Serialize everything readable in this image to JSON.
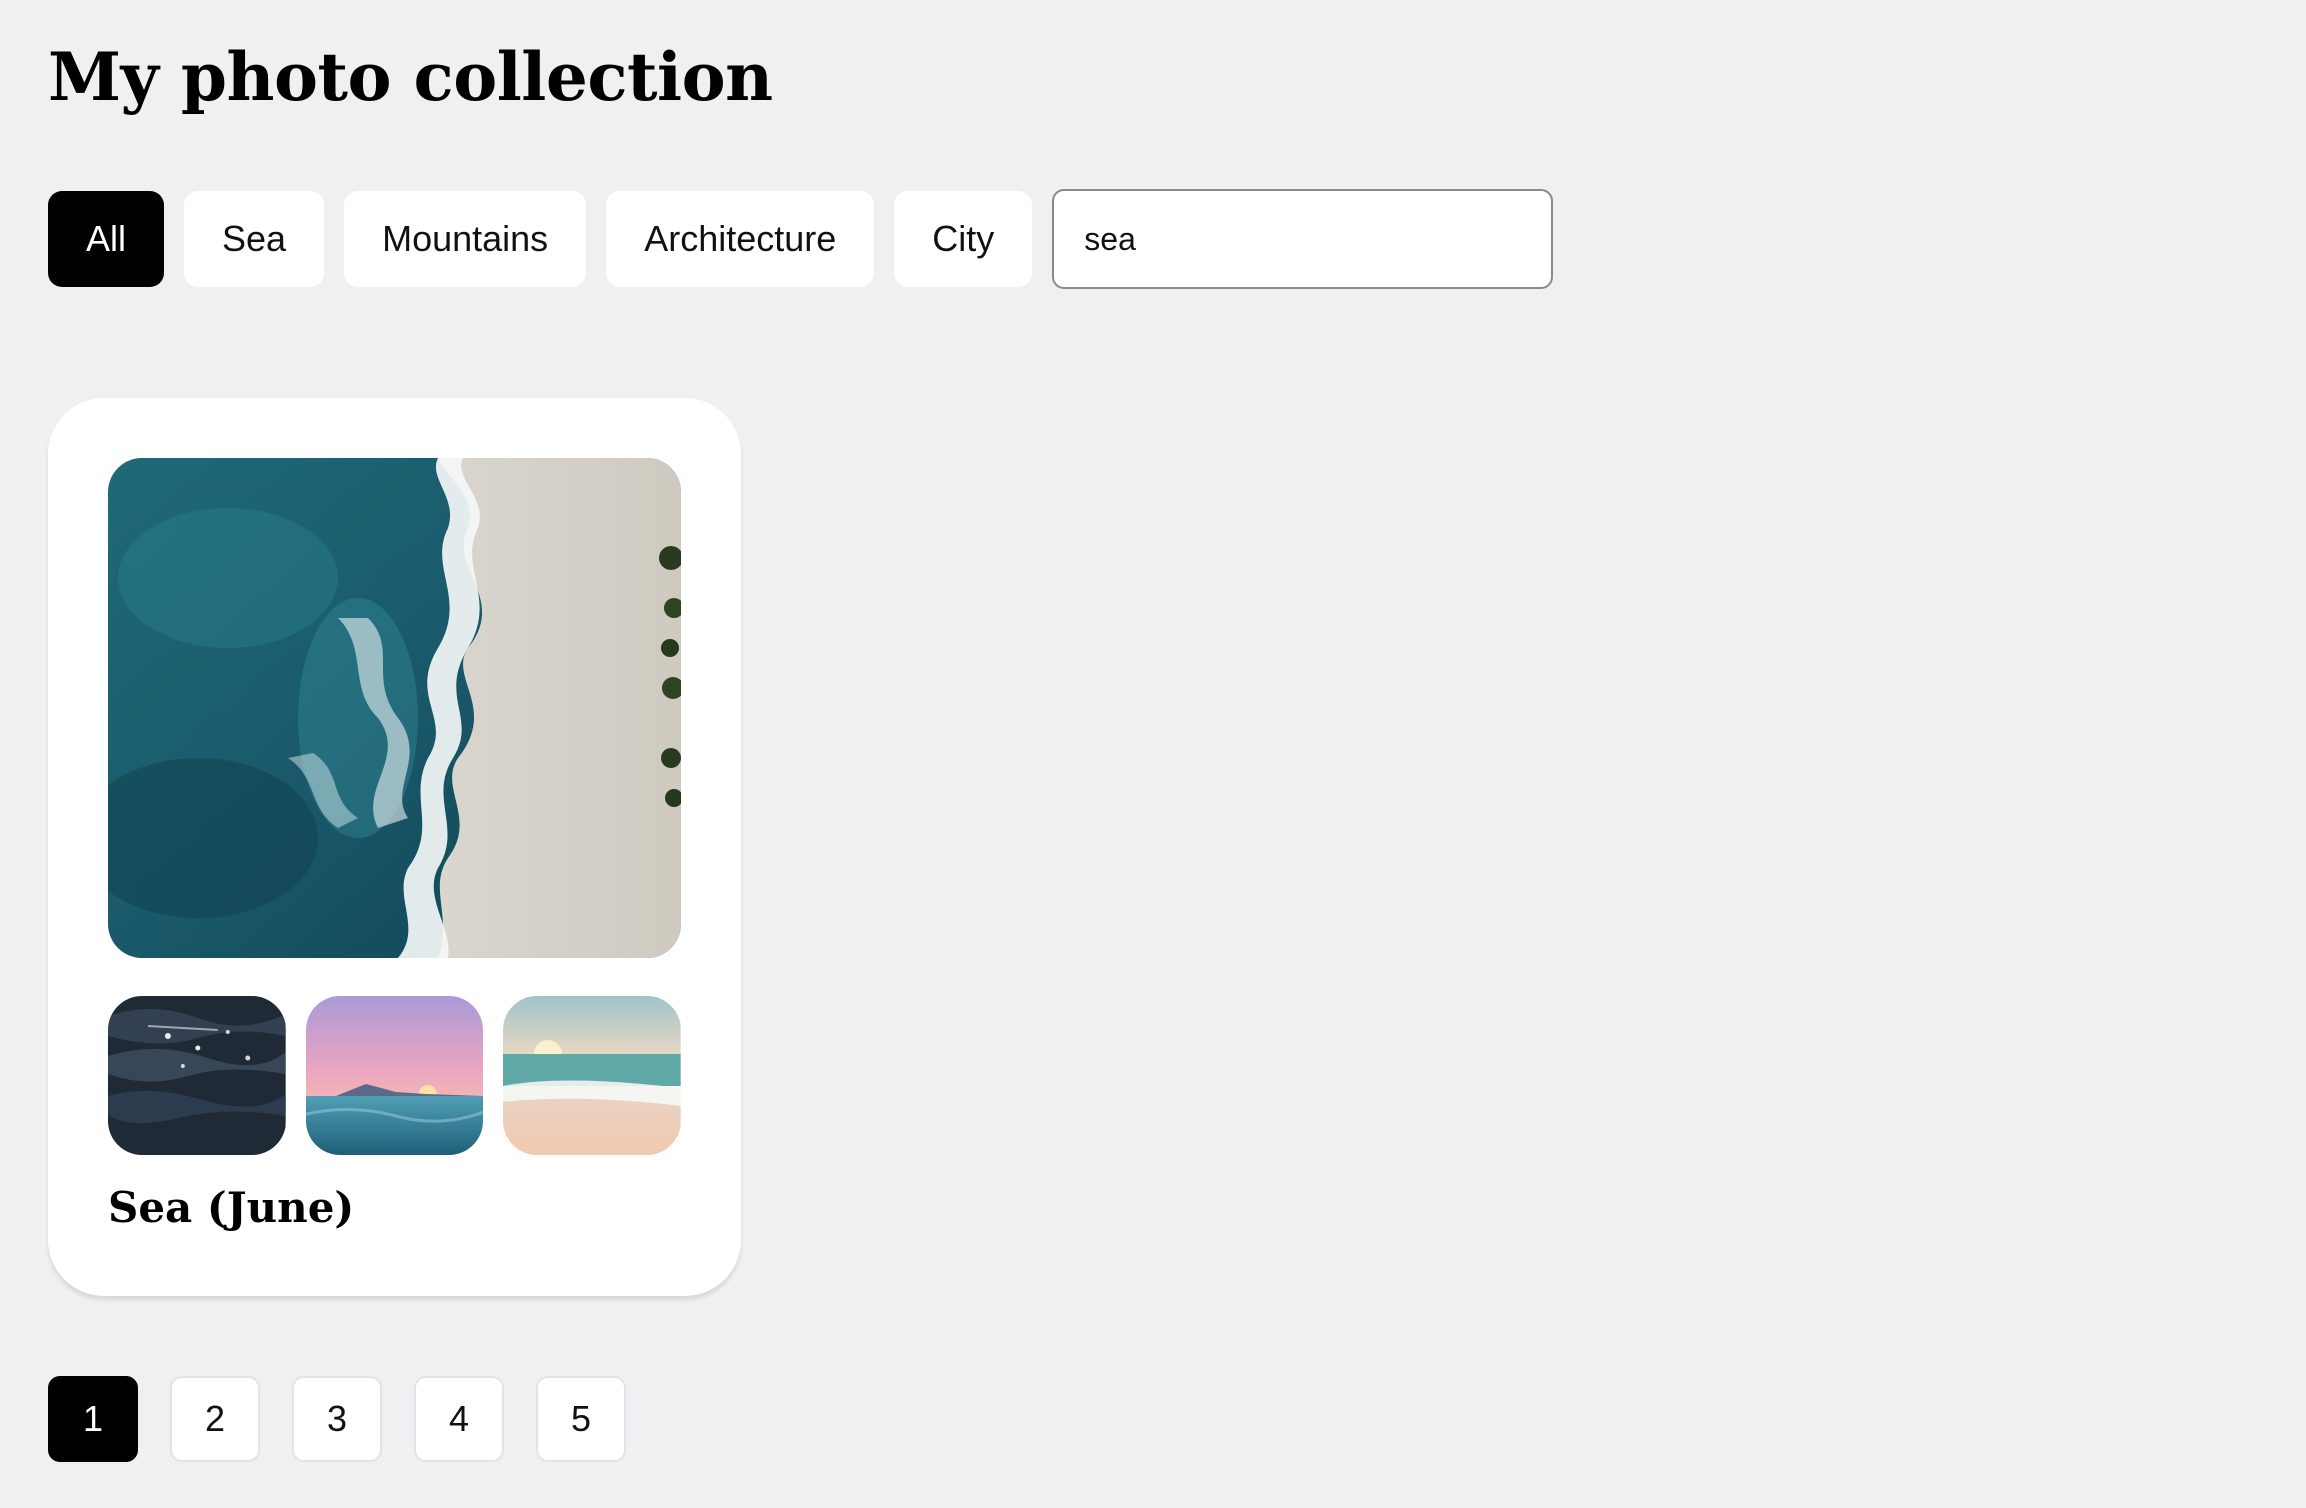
{
  "page": {
    "title": "My photo collection"
  },
  "filters": {
    "items": [
      {
        "label": "All",
        "active": true
      },
      {
        "label": "Sea",
        "active": false
      },
      {
        "label": "Mountains",
        "active": false
      },
      {
        "label": "Architecture",
        "active": false
      },
      {
        "label": "City",
        "active": false
      }
    ]
  },
  "search": {
    "value": "sea",
    "placeholder": ""
  },
  "collection": {
    "title": "Sea (June)",
    "main_photo": "aerial-sea-shore-photo",
    "thumbnails": [
      "dark-waves-photo",
      "pink-sunset-sea-photo",
      "beach-sunset-photo"
    ]
  },
  "pagination": {
    "pages": [
      "1",
      "2",
      "3",
      "4",
      "5"
    ],
    "current": "1"
  },
  "colors": {
    "background": "#eff0f2",
    "active": "#000000",
    "surface": "#ffffff"
  }
}
